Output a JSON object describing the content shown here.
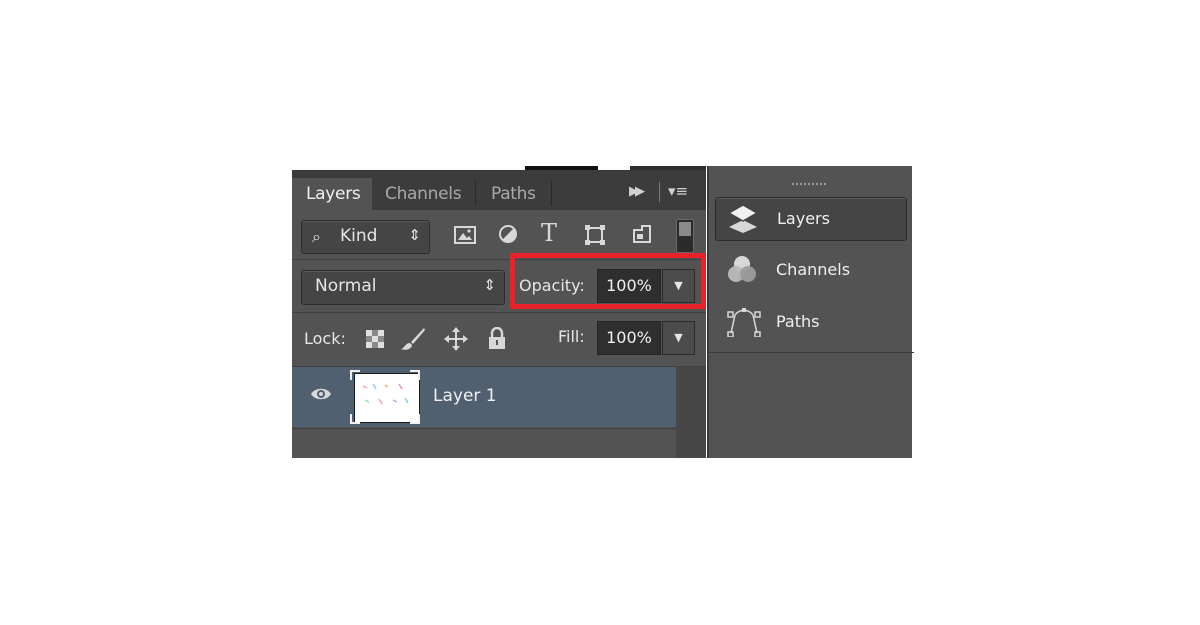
{
  "tabs": [
    {
      "label": "Layers",
      "active": true
    },
    {
      "label": "Channels",
      "active": false
    },
    {
      "label": "Paths",
      "active": false
    }
  ],
  "filter": {
    "kind_label": "Kind",
    "icons": [
      "image-filter-icon",
      "adjustment-filter-icon",
      "type-filter-icon",
      "shape-filter-icon",
      "smart-object-filter-icon"
    ]
  },
  "blend_mode": "Normal",
  "opacity": {
    "label": "Opacity:",
    "value": "100%"
  },
  "lock": {
    "label": "Lock:",
    "icons": [
      "lock-transparent-pixels-icon",
      "lock-image-pixels-icon",
      "lock-position-icon",
      "lock-all-icon"
    ]
  },
  "fill": {
    "label": "Fill:",
    "value": "100%"
  },
  "layers": [
    {
      "name": "Layer 1",
      "visible": true,
      "selected": true
    }
  ],
  "side_panel": {
    "items": [
      {
        "label": "Layers",
        "icon": "layers-icon",
        "active": true
      },
      {
        "label": "Channels",
        "icon": "channels-icon",
        "active": false
      },
      {
        "label": "Paths",
        "icon": "paths-icon",
        "active": false
      }
    ]
  },
  "colors": {
    "panel_bg": "#535353",
    "tab_bar": "#3c3c3c",
    "selected_layer": "#516070",
    "highlight": "#e8212b"
  }
}
